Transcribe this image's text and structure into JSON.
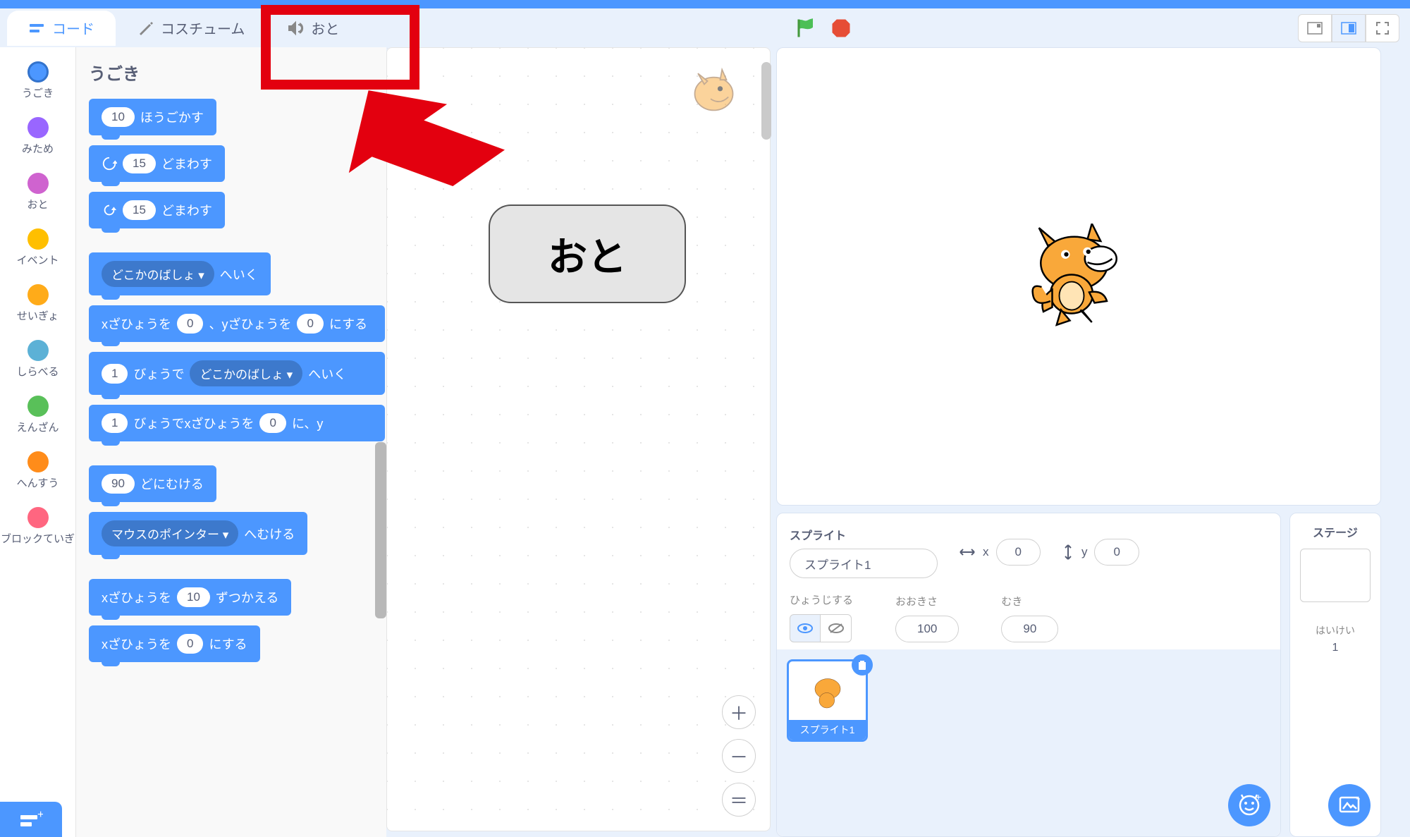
{
  "tabs": {
    "code": "コード",
    "costumes": "コスチューム",
    "sounds": "おと"
  },
  "callout": "おと",
  "categories": [
    {
      "name": "うごき",
      "color": "#4c97ff"
    },
    {
      "name": "みため",
      "color": "#9966ff"
    },
    {
      "name": "おと",
      "color": "#cf63cf"
    },
    {
      "name": "イベント",
      "color": "#ffbf00"
    },
    {
      "name": "せいぎょ",
      "color": "#ffab19"
    },
    {
      "name": "しらべる",
      "color": "#5cb1d6"
    },
    {
      "name": "えんざん",
      "color": "#59c059"
    },
    {
      "name": "へんすう",
      "color": "#ff8c1a"
    },
    {
      "name": "ブロックていぎ",
      "color": "#ff6680"
    }
  ],
  "palette": {
    "title": "うごき",
    "blocks": {
      "move": {
        "val": "10",
        "txt": "ほうごかす"
      },
      "turnR": {
        "val": "15",
        "txt": "どまわす"
      },
      "turnL": {
        "val": "15",
        "txt": "どまわす"
      },
      "goto": {
        "drop": "どこかのばしょ ▾",
        "txt": "へいく"
      },
      "gotoxy": {
        "p1": "xざひょうを",
        "v1": "0",
        "p2": "、yざひょうを",
        "v2": "0",
        "p3": "にする"
      },
      "glide": {
        "v1": "1",
        "p1": "びょうで",
        "drop": "どこかのばしょ ▾",
        "p2": "へいく"
      },
      "glidexy": {
        "v1": "1",
        "p1": "びょうでxざひょうを",
        "v2": "0",
        "p2": "に、y"
      },
      "point": {
        "v1": "90",
        "txt": "どにむける"
      },
      "pointTo": {
        "drop": "マウスのポインター ▾",
        "txt": "へむける"
      },
      "changeX": {
        "p1": "xざひょうを",
        "v1": "10",
        "p2": "ずつかえる"
      },
      "setX": {
        "p1": "xざひょうを",
        "v1": "0",
        "p2": "にする"
      }
    }
  },
  "spritePanel": {
    "label": "スプライト",
    "name": "スプライト1",
    "xLabel": "x",
    "x": "0",
    "yLabel": "y",
    "y": "0",
    "showLabel": "ひょうじする",
    "sizeLabel": "おおきさ",
    "size": "100",
    "dirLabel": "むき",
    "dir": "90",
    "thumbName": "スプライト1"
  },
  "stagePanel": {
    "title": "ステージ",
    "backdropLabel": "はいけい",
    "count": "1"
  }
}
